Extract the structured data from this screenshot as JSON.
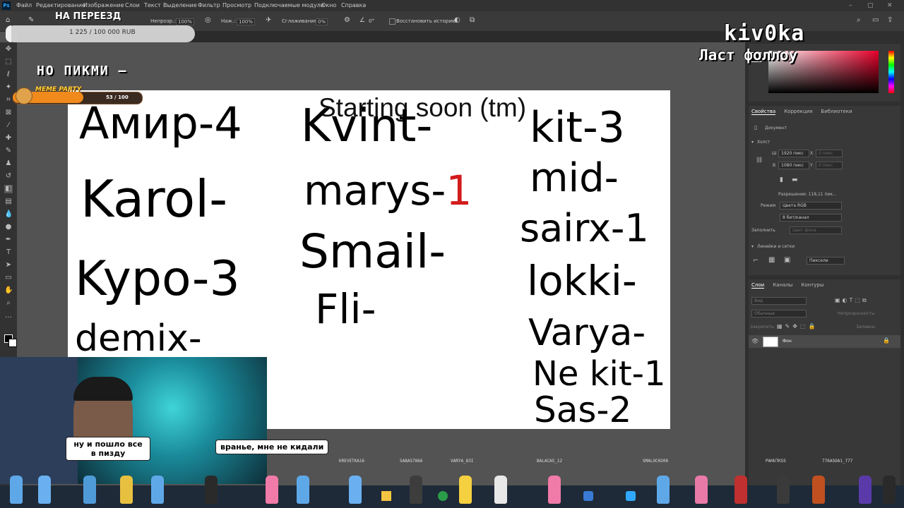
{
  "menu": {
    "items": [
      "Файл",
      "Редактирование",
      "Изображение",
      "Слои",
      "Текст",
      "Выделение",
      "Фильтр",
      "Просмотр",
      "Подключаемые модули",
      "Окно",
      "Справка"
    ]
  },
  "options_bar": {
    "opacity_label": "Непрозр.:",
    "opacity_value": "100%",
    "pressure_label": "Наж.:",
    "pressure_value": "100%",
    "smoothing_label": "Сглаживание:",
    "smoothing_value": "0%",
    "angle_value": "0°",
    "history_label": "Восстановить историю"
  },
  "overlay": {
    "goal_title": "НА ПЕРЕЕЗД",
    "goal_amount": "1 225 / 100 000 RUB",
    "channel_name": "kiv0ka",
    "last_follow_label": "Ласт фоллоу",
    "pikmi_text": "НО ПИКМИ –",
    "meme_label": "MEME PARTY",
    "meme_count": "53 / 100"
  },
  "canvas": {
    "title": "Starting soon (tm)",
    "col1": [
      "Амир-4",
      "Karol-",
      "Kypo-3",
      "demix-"
    ],
    "col2_kvint": "Kvint-",
    "col2_marys": "marys-",
    "col2_marys_num": "1",
    "col2_rest": [
      "Smail-",
      "Fli-"
    ],
    "col3": [
      "kit-3",
      "mid-",
      "sairx-1",
      "lokki-",
      "Varya-",
      "Ne kit-1",
      "Sas-2"
    ]
  },
  "properties": {
    "tabs": [
      "Свойства",
      "Коррекция",
      "Библиотеки"
    ],
    "doc_label": "Документ",
    "canvas_section": "Холст",
    "width_value": "1920 пикс",
    "height_value": "1080 пикс",
    "w_letter": "Ш",
    "h_letter": "В",
    "x_letter": "X",
    "y_letter": "Y",
    "resolution": "Разрешение: 118,11 пик...",
    "mode_label": "Режим",
    "mode_value": "Цвета RGB",
    "depth_value": "8 бит/канал",
    "fill_label": "Заполнить",
    "grid_section": "Линейки и сетки",
    "units_value": "Пиксели"
  },
  "layers": {
    "tabs": [
      "Слои",
      "Каналы",
      "Контуры"
    ],
    "search_placeholder": "Вид",
    "blend_value": "Обычные",
    "opacity_label": "Непрозрачность:",
    "lock_label": "Закрепить:",
    "fill_label": "Заливка:",
    "layer_name": "Фон"
  },
  "webcam": {
    "bubble1": "ну и пошло все в пизду",
    "bubble2": "вранье, мне не кидали"
  },
  "viewers": [
    "KREVETKA16",
    "SABAS7866",
    "VARYA_83I",
    "BALACAS_12",
    "SMALOCH208",
    "PAHUTKSS",
    "776ASOA1_777"
  ],
  "colors": {
    "accent": "#31a8ff",
    "canvas_bg": "#ffffff",
    "red_ink": "#d21b1b",
    "meme_orange": "#f08a1c"
  }
}
